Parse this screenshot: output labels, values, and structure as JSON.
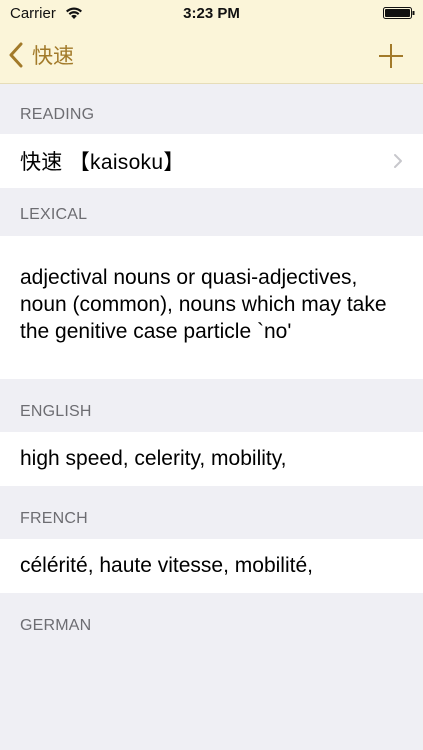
{
  "status_bar": {
    "carrier": "Carrier",
    "time": "3:23 PM"
  },
  "nav": {
    "back_label": "快速",
    "back_icon": "chevron-left-icon",
    "add_icon": "plus-icon"
  },
  "sections": {
    "reading": {
      "header": "READING",
      "value": "快速 【kaisoku】"
    },
    "lexical": {
      "header": "LEXICAL",
      "value": "adjectival nouns or quasi-adjectives, noun (common), nouns which may take the genitive case particle `no'"
    },
    "english": {
      "header": "ENGLISH",
      "value": "high speed, celerity, mobility,"
    },
    "french": {
      "header": "FRENCH",
      "value": "célérité, haute vitesse, mobilité,"
    },
    "german": {
      "header": "GERMAN"
    }
  },
  "colors": {
    "nav_background": "#fbf5d9",
    "accent": "#a27a2a",
    "page_background": "#efeff4"
  }
}
